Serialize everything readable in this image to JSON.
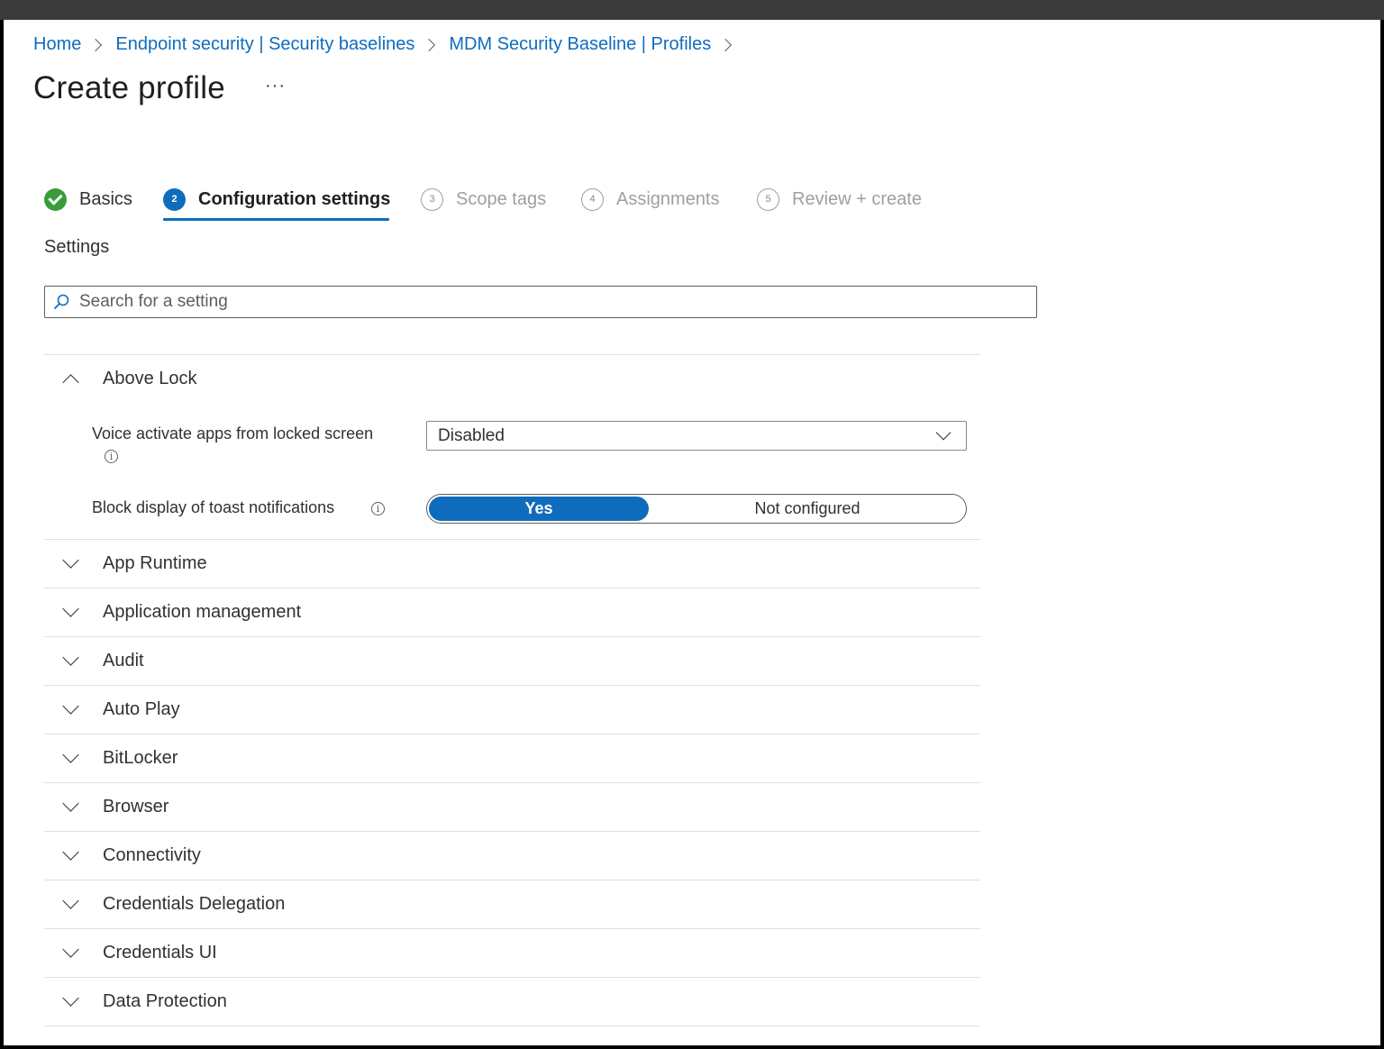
{
  "breadcrumb": [
    "Home",
    "Endpoint security | Security baselines",
    "MDM Security Baseline | Profiles"
  ],
  "page": {
    "title": "Create profile",
    "more_label": "···"
  },
  "wizard": {
    "steps": [
      {
        "label": "Basics",
        "state": "done",
        "number": ""
      },
      {
        "label": "Configuration settings",
        "state": "current",
        "number": "2"
      },
      {
        "label": "Scope tags",
        "state": "future",
        "number": "3"
      },
      {
        "label": "Assignments",
        "state": "future",
        "number": "4"
      },
      {
        "label": "Review + create",
        "state": "future",
        "number": "5"
      }
    ]
  },
  "settings": {
    "heading": "Settings",
    "search_placeholder": "Search for a setting",
    "expanded_section": {
      "title": "Above Lock",
      "voice_label": "Voice activate apps from locked screen",
      "voice_value": "Disabled",
      "toast_label": "Block display of toast notifications",
      "toast_options": [
        "Yes",
        "Not configured"
      ],
      "toast_selected": "Yes"
    },
    "sections": [
      "App Runtime",
      "Application management",
      "Audit",
      "Auto Play",
      "BitLocker",
      "Browser",
      "Connectivity",
      "Credentials Delegation",
      "Credentials UI",
      "Data Protection"
    ]
  },
  "colors": {
    "accent": "#0f6cbd",
    "success": "#3a9b3a",
    "muted": "#a19f9d"
  }
}
